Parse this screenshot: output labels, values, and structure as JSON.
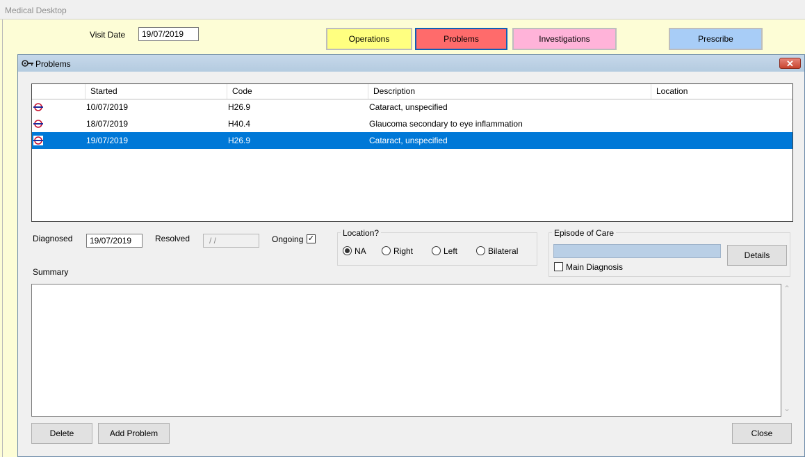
{
  "window": {
    "title": "Medical Desktop"
  },
  "visit": {
    "label": "Visit Date",
    "date": "19/07/2019"
  },
  "categories": [
    {
      "label": "Operations",
      "color": "#ffff80"
    },
    {
      "label": "Problems",
      "color": "#ff6b6b"
    },
    {
      "label": "Investigations",
      "color": "#ffb3d9"
    },
    {
      "label": "Prescribe",
      "color": "#a8cdf7"
    }
  ],
  "dialog": {
    "title": "Problems",
    "close_glyph": "✕",
    "columns": [
      "Started",
      "Code",
      "Description",
      "Location"
    ],
    "rows": [
      {
        "started": "10/07/2019",
        "code": "H26.9",
        "description": "Cataract, unspecified",
        "location": "",
        "selected": false
      },
      {
        "started": "18/07/2019",
        "code": "H40.4",
        "description": "Glaucoma secondary to eye inflammation",
        "location": "",
        "selected": false
      },
      {
        "started": "19/07/2019",
        "code": "H26.9",
        "description": "Cataract, unspecified",
        "location": "",
        "selected": true
      }
    ],
    "diagnosed": {
      "label": "Diagnosed",
      "value": "19/07/2019"
    },
    "resolved": {
      "label": "Resolved",
      "value": "/ /"
    },
    "ongoing": {
      "label": "Ongoing",
      "checked": true,
      "glyph": "✓"
    },
    "location_group": {
      "title": "Location?",
      "options": [
        "NA",
        "Right",
        "Left",
        "Bilateral"
      ],
      "selected": "NA"
    },
    "episode": {
      "title": "Episode of Care",
      "details_label": "Details",
      "main_diagnosis_label": "Main Diagnosis",
      "main_diagnosis_checked": false
    },
    "summary": {
      "label": "Summary",
      "value": ""
    },
    "buttons": {
      "delete": "Delete",
      "add": "Add Problem",
      "close": "Close"
    },
    "scroll_up": "⌃",
    "scroll_down": "⌄"
  }
}
